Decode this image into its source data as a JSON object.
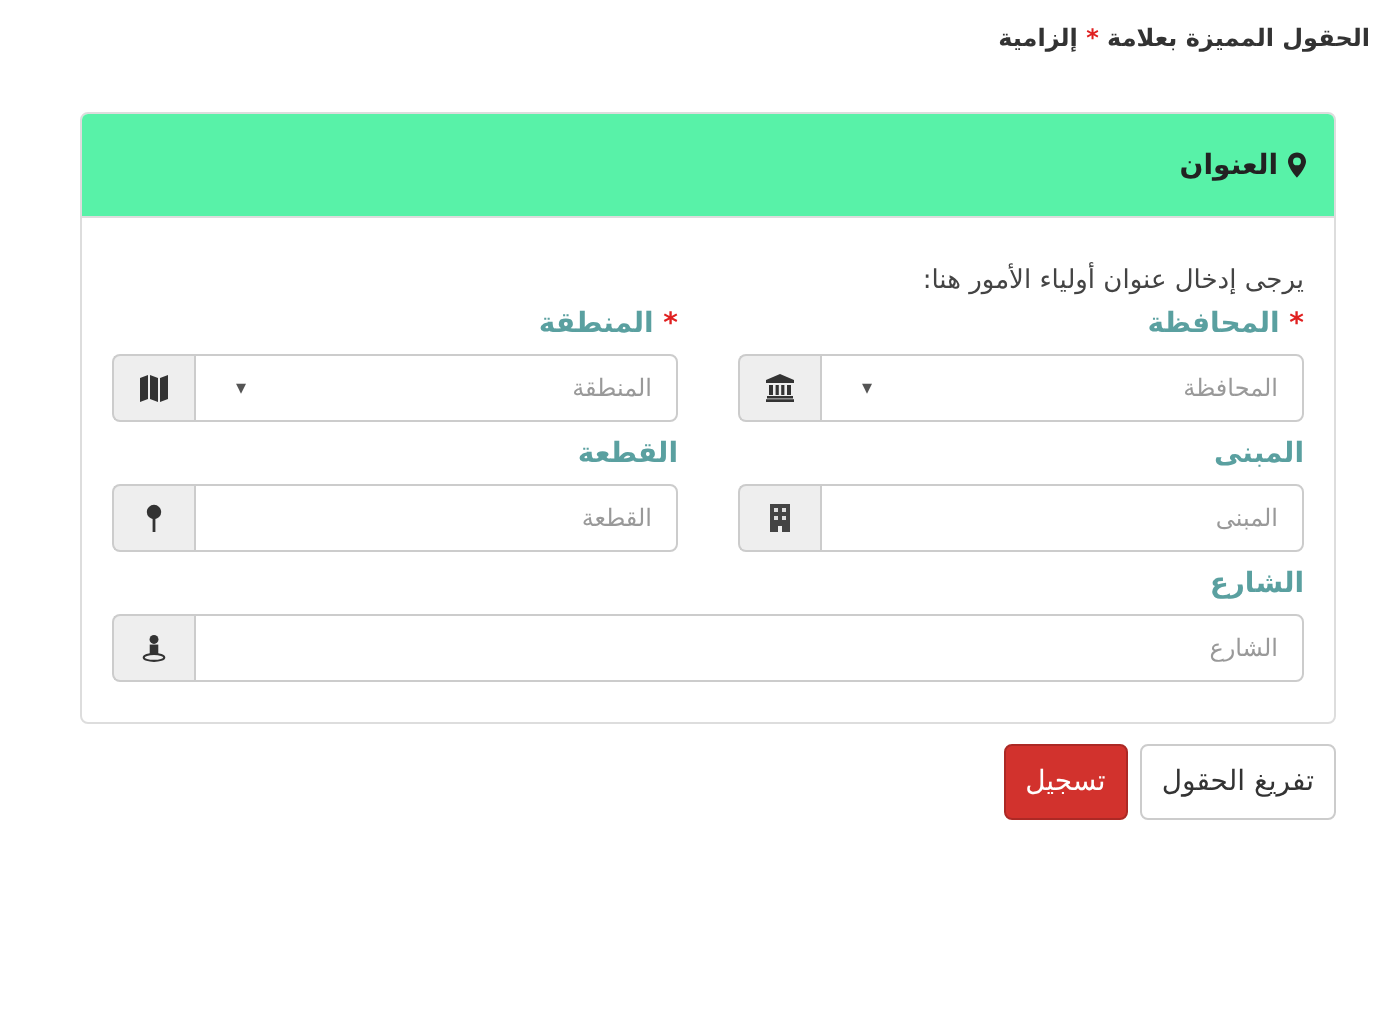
{
  "required_note": {
    "before": "الحقول المميزة بعلامة",
    "mark": "*",
    "after": "إلزامية"
  },
  "panel": {
    "title": "العنوان",
    "intro": "يرجى إدخال عنوان أولياء الأمور هنا:",
    "fields": [
      {
        "kind": "select",
        "label": "المحافظة",
        "required_mark": "*",
        "placeholder": "المحافظة",
        "caret": "▾"
      },
      {
        "kind": "select",
        "label": "المنطقة",
        "required_mark": "*",
        "placeholder": "المنطقة",
        "caret": "▾"
      },
      {
        "kind": "text",
        "label": "المبنى",
        "placeholder": "المبنى"
      },
      {
        "kind": "text",
        "label": "القطعة",
        "placeholder": "القطعة"
      },
      {
        "kind": "wide",
        "label": "الشارع",
        "placeholder": "الشارع"
      }
    ]
  },
  "buttons": [
    {
      "kind": "default",
      "label": "تفريغ الحقول"
    },
    {
      "kind": "danger",
      "label": "تسجيل"
    }
  ]
}
